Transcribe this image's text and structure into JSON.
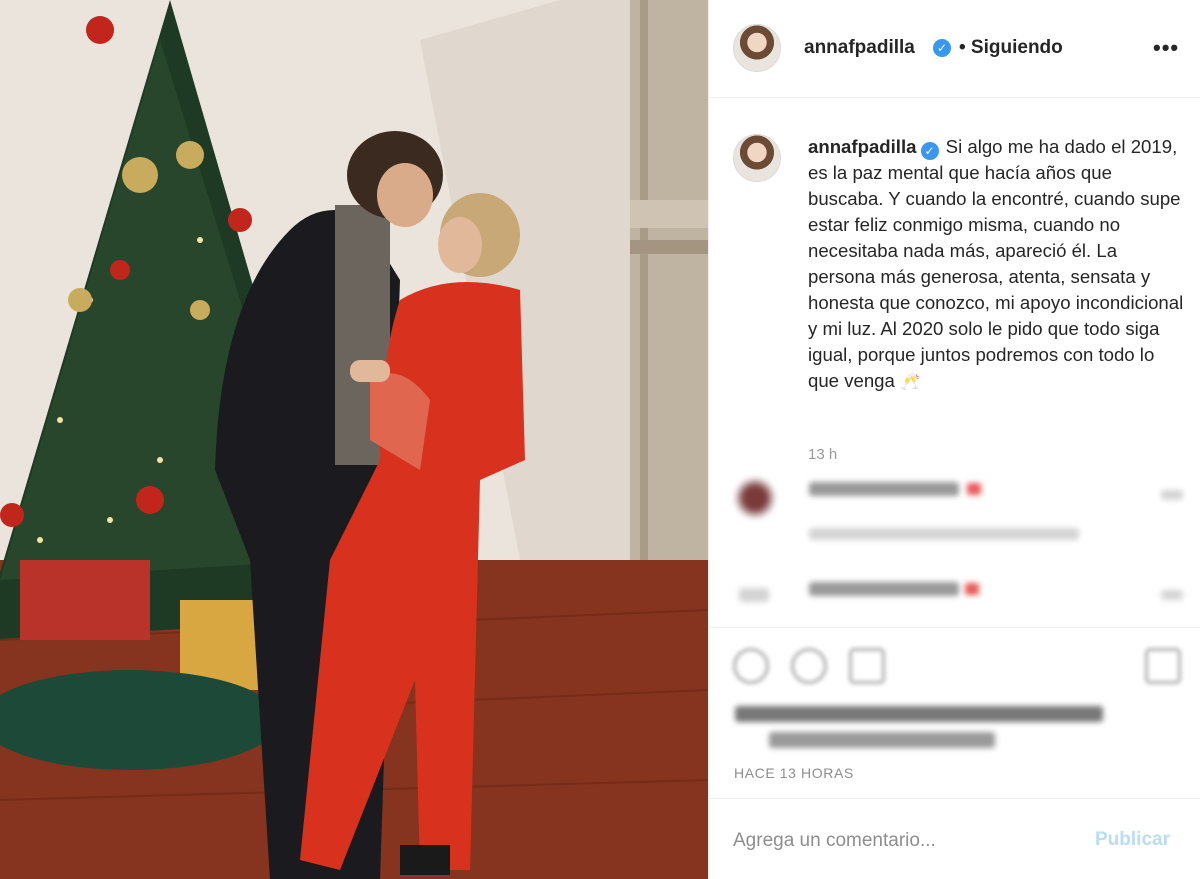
{
  "post": {
    "username": "annafpadilla",
    "verified_glyph": "✓",
    "following_label": "• Siguiendo",
    "more_glyph": "•••"
  },
  "caption": {
    "username": "annafpadilla",
    "text": "Si algo me ha dado el 2019, es la paz mental que hacía años que buscaba. Y cuando la encontré, cuando supe estar feliz conmigo misma, cuando no necesitaba nada más, apareció él. La persona más generosa, atenta, sensata y honesta que conozco, mi apoyo incondicional y mi luz. Al 2020 solo le pido que todo siga igual, porque juntos podremos con todo lo que venga",
    "emoji": "🥂",
    "time": "13 h"
  },
  "footer": {
    "timestamp": "HACE 13 HORAS",
    "comment_placeholder": "Agrega un comentario...",
    "publish_label": "Publicar"
  },
  "icons": {
    "like": "heart-icon",
    "comment": "comment-icon",
    "share": "share-icon",
    "save": "bookmark-icon",
    "verified": "verified-badge-icon",
    "more": "more-options-icon"
  },
  "colors": {
    "verified_blue": "#3897f0",
    "publish_disabled": "#b9dcfa",
    "dress_red": "#d8321f"
  }
}
